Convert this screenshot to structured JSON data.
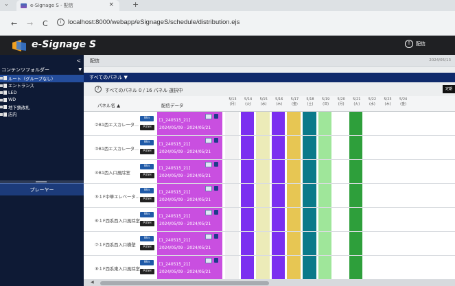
{
  "browser": {
    "tab_title": "e-Signage S - 配信",
    "tab_close": "×",
    "new_tab": "+",
    "tab_list": "⌄",
    "back": "←",
    "forward": "→",
    "reload": "C",
    "info": "i",
    "url": "localhost:8000/webapp/eSignageS/schedule/distribution.ejs"
  },
  "app": {
    "logo_text": "e-Signage S",
    "distribute_label": "配信",
    "distribute_icon_glyph": "⠿"
  },
  "sidebar": {
    "collapse": "<",
    "title": "コンテンツフォルダー",
    "title_arrow": "▼",
    "tree": [
      {
        "label": "ルート（グループなし）",
        "selected": true
      },
      {
        "label": "エントランス",
        "selected": false
      },
      {
        "label": "LED",
        "selected": false
      },
      {
        "label": "WD",
        "selected": false
      },
      {
        "label": "地下鉄改札",
        "selected": false
      },
      {
        "label": "店内",
        "selected": false
      }
    ],
    "player_label": "プレーヤー"
  },
  "main": {
    "breadcrumb": "配信",
    "date_right": "2024/05/13",
    "panel_selector": "すべてのパネル ▼",
    "status_icon": "?",
    "status_text": "すべてのパネル 0 / 16 パネル 選択中",
    "right_button": "定期",
    "col_panel": "パネル名 ▲",
    "col_data": "配信データ",
    "days": [
      {
        "d": "5/13",
        "w": "(月)",
        "color": "#f2f2f2"
      },
      {
        "d": "5/14",
        "w": "(火)",
        "color": "#7b2ff0"
      },
      {
        "d": "5/15",
        "w": "(水)",
        "color": "#ecebb8"
      },
      {
        "d": "5/16",
        "w": "(木)",
        "color": "#7b2ff0"
      },
      {
        "d": "5/17",
        "w": "(金)",
        "color": "#e7c653"
      },
      {
        "d": "5/18",
        "w": "(土)",
        "color": "#0b7a8a"
      },
      {
        "d": "5/19",
        "w": "(日)",
        "color": "#9fe69a"
      },
      {
        "d": "5/20",
        "w": "(月)",
        "color": "#ffffff"
      },
      {
        "d": "5/21",
        "w": "(火)",
        "color": "#2e9f3b"
      },
      {
        "d": "5/22",
        "w": "(水)",
        "color": "#ffffff"
      },
      {
        "d": "5/23",
        "w": "(木)",
        "color": "#ffffff"
      },
      {
        "d": "5/24",
        "w": "(金)",
        "color": "#ffffff"
      }
    ],
    "rows": [
      {
        "name": "②B1西エスカレータ...",
        "win": "Win",
        "push": "PUSH",
        "data1": "[1_240515_21]",
        "data2": "2024/05/09 - 2024/05/21"
      },
      {
        "name": "③B1西エスカレータ...",
        "win": "Win",
        "push": "PUSH",
        "data1": "[1_240515_21]",
        "data2": "2024/05/09 - 2024/05/21"
      },
      {
        "name": "④B1西入口風除室",
        "win": "Win",
        "push": "PUSH",
        "data1": "[1_240515_21]",
        "data2": "2024/05/09 - 2024/05/21"
      },
      {
        "name": "⑤１F中華エレベータ...",
        "win": "Win",
        "push": "PUSH",
        "data1": "[1_240515_21]",
        "data2": "2024/05/09 - 2024/05/21"
      },
      {
        "name": "⑥１F西系西入口風除室",
        "win": "Win",
        "push": "PUSH",
        "data1": "[1_240515_21]",
        "data2": "2024/05/09 - 2024/05/21"
      },
      {
        "name": "⑦１F西系西入口横壁",
        "win": "Win",
        "push": "PUSH",
        "data1": "[1_240515_21]",
        "data2": "2024/05/09 - 2024/05/21"
      },
      {
        "name": "⑧１F西系東入口風除室",
        "win": "Win",
        "push": "PUSH",
        "data1": "[1_240515_21]",
        "data2": "2024/05/09 - 2024/05/21"
      }
    ],
    "scroll_left": "◀"
  }
}
